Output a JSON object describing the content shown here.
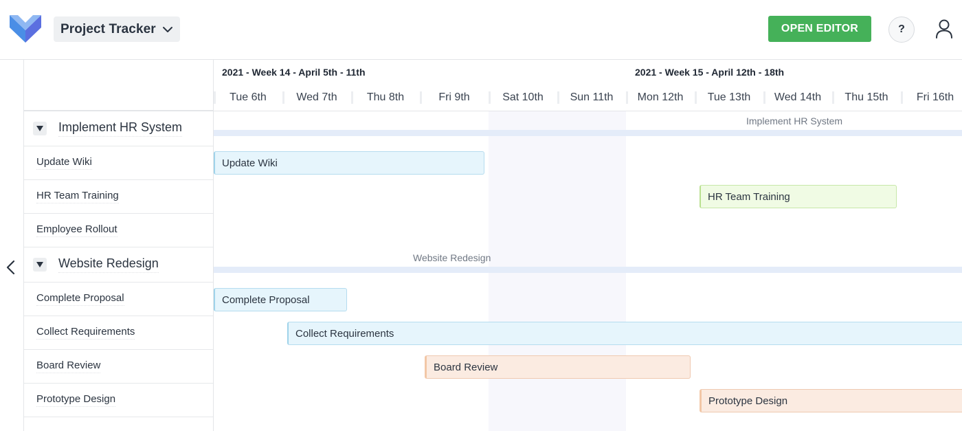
{
  "header": {
    "project_name": "Project Tracker",
    "open_editor_label": "OPEN EDITOR",
    "help_label": "?",
    "accent_color": "#45b159"
  },
  "timeline": {
    "weeks": [
      "2021 - Week 14 - April 5th - 11th",
      "2021 - Week 15 - April 12th - 18th"
    ],
    "days": [
      "Tue 6th",
      "Wed 7th",
      "Thu 8th",
      "Fri 9th",
      "Sat 10th",
      "Sun 11th",
      "Mon 12th",
      "Tue 13th",
      "Wed 14th",
      "Thu 15th",
      "Fri 16th"
    ]
  },
  "tasks": {
    "group1": {
      "name": "Implement HR System",
      "items": [
        "Update Wiki",
        "HR Team Training",
        "Employee Rollout"
      ]
    },
    "group2": {
      "name": "Website Redesign",
      "items": [
        "Complete Proposal",
        "Collect Requirements",
        "Board Review",
        "Prototype Design"
      ]
    }
  },
  "icons": {
    "logo": "logo-icon",
    "project_dropdown": "chevron-down-icon",
    "user": "user-icon",
    "collapse": "chevron-left-icon",
    "group_toggle": "triangle-down-icon"
  }
}
